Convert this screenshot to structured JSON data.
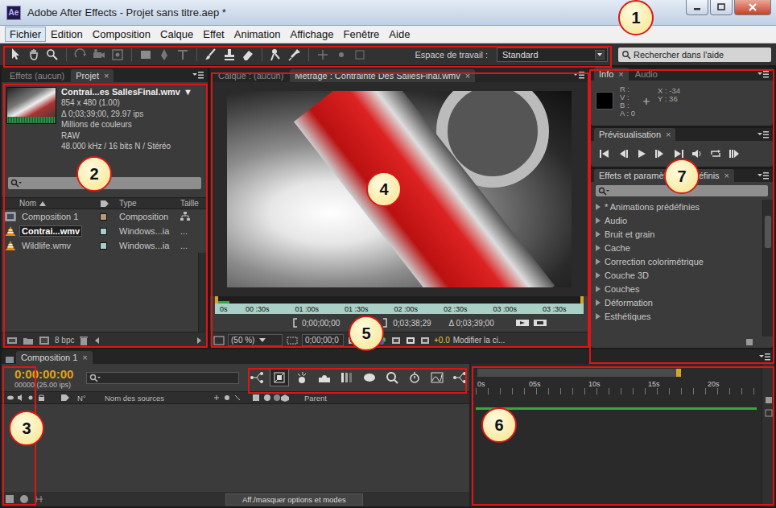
{
  "window": {
    "logo": "Ae",
    "title": "Adobe After Effects - Projet sans titre.aep *"
  },
  "menu": [
    {
      "label": "Fichier",
      "selected": true
    },
    {
      "label": "Edition",
      "selected": false
    },
    {
      "label": "Composition",
      "selected": false
    },
    {
      "label": "Calque",
      "selected": false
    },
    {
      "label": "Effet",
      "selected": false
    },
    {
      "label": "Animation",
      "selected": false
    },
    {
      "label": "Affichage",
      "selected": false
    },
    {
      "label": "Fenêtre",
      "selected": false
    },
    {
      "label": "Aide",
      "selected": false
    }
  ],
  "toolbar": {
    "workspace_label": "Espace de travail :",
    "workspace_value": "Standard",
    "search_placeholder": "Rechercher dans l'aide"
  },
  "project": {
    "tabs": [
      {
        "label": "Effets (aucun)",
        "selected": false
      },
      {
        "label": "Projet",
        "selected": true,
        "close": "×"
      }
    ],
    "file": {
      "name": "Contrai...es SallesFinal.wmv",
      "arrow": "▼",
      "details": [
        "854 x 480 (1.00)",
        "Δ 0;03;39;00, 29.97 ips",
        "Millions de couleurs",
        "RAW",
        "48.000 kHz / 16 bits N / Stéréo"
      ]
    },
    "columns": [
      "Nom",
      "Type",
      "Taille"
    ],
    "rows": [
      {
        "name": "Composition 1",
        "type": "Composition",
        "kind": "composition",
        "color": "#b59c77",
        "selected": false
      },
      {
        "name": "Contrai...wmv",
        "type": "Windows...ia",
        "size": "...",
        "kind": "video",
        "color": "#a8cccc",
        "selected": true
      },
      {
        "name": "Wildlife.wmv",
        "type": "Windows...ia",
        "size": "...",
        "kind": "video",
        "color": "#a8cccc",
        "selected": false
      }
    ],
    "bpc": "8 bpc"
  },
  "viewer": {
    "tabs": [
      {
        "label": "Calque : (aucun)",
        "selected": false
      },
      {
        "label": "Métrage : Contrainte Des SallesFinal.wmv",
        "selected": true,
        "close": "×"
      }
    ],
    "ruler": [
      "0s",
      "00 :30s",
      "01 :00s",
      "01 :30s",
      "02 :00s",
      "02 :30s",
      "03 :00s",
      "03 :30s"
    ],
    "in_time": "0;00;00;00",
    "out_time": "0;03;38;29",
    "duration": "Δ 0;03;39;00",
    "zoom": "(50 %)",
    "time_field": "0;00;00;0",
    "exposure": "+0.0",
    "edit_label": "Modifier la ci..."
  },
  "info": {
    "tabs": [
      {
        "label": "Info",
        "selected": true,
        "close": "×"
      },
      {
        "label": "Audio",
        "selected": false
      }
    ],
    "channels": [
      "R :",
      "V :",
      "B :",
      "A : 0"
    ],
    "x": "X : -34",
    "y": "Y : 36"
  },
  "preview": {
    "tabs": [
      {
        "label": "Prévisualisation",
        "selected": true,
        "close": "×"
      }
    ]
  },
  "effects": {
    "tabs": [
      {
        "label": "Effets et paramètres prédéfinis",
        "selected": true,
        "close": "×"
      }
    ],
    "items": [
      "* Animations prédéfinies",
      "Audio",
      "Bruit et grain",
      "Cache",
      "Correction colorimétrique",
      "Couche 3D",
      "Couches",
      "Déformation",
      "Esthétiques"
    ]
  },
  "timeline": {
    "tabs": [
      {
        "label": "Composition 1",
        "selected": true,
        "close": "×"
      }
    ],
    "time": "0:00:00:00",
    "frames": "00000 (25.00 ips)",
    "switches": [
      {
        "on": false
      },
      {
        "on": true
      },
      {
        "on": false
      },
      {
        "on": false
      },
      {
        "on": false
      },
      {
        "on": false
      },
      {
        "on": false
      },
      {
        "on": false
      },
      {
        "on": false
      },
      {
        "on": false
      }
    ],
    "columns": [
      "N°",
      "Nom des sources",
      "Parent"
    ],
    "ruler": [
      "0s",
      "05s",
      "10s",
      "15s",
      "20s"
    ],
    "toggle_button": "Aff./masquer options et modes"
  },
  "annotations": [
    "1",
    "2",
    "3",
    "4",
    "5",
    "6",
    "7"
  ]
}
